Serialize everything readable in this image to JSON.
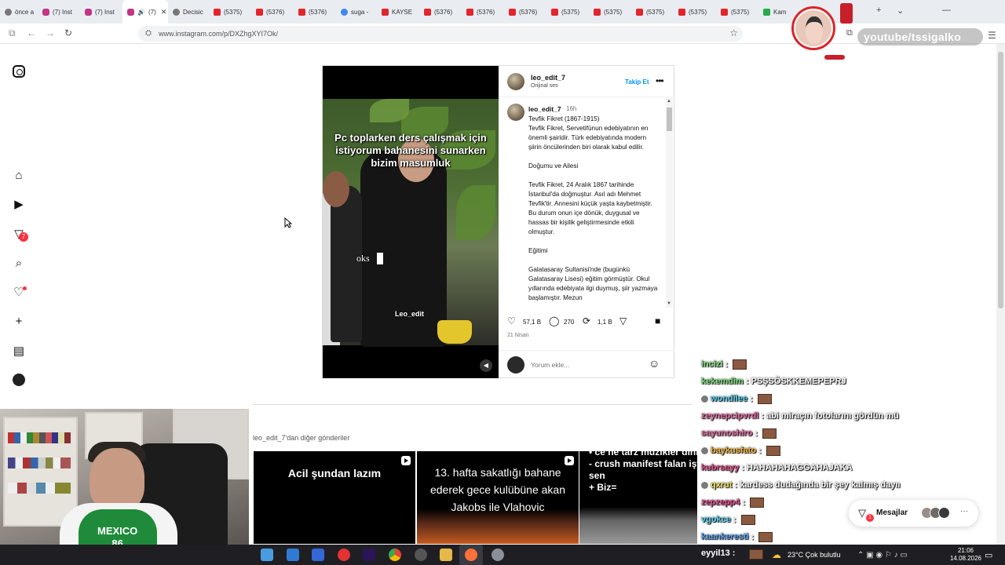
{
  "browser": {
    "tabs": [
      {
        "label": "önce a",
        "icon": "gray",
        "active": false
      },
      {
        "label": "(7) Inst",
        "icon": "ig",
        "active": false
      },
      {
        "label": "(7) Inst",
        "icon": "ig",
        "active": false
      },
      {
        "label": "(7)",
        "icon": "ig",
        "active": true
      },
      {
        "label": "Decisic",
        "icon": "gray",
        "active": false
      },
      {
        "label": "(5375)",
        "icon": "yt",
        "active": false
      },
      {
        "label": "(5376)",
        "icon": "yt",
        "active": false
      },
      {
        "label": "(5376)",
        "icon": "yt",
        "active": false
      },
      {
        "label": "suga -",
        "icon": "google",
        "active": false
      },
      {
        "label": "KAYSE",
        "icon": "yt",
        "active": false
      },
      {
        "label": "(5376)",
        "icon": "yt",
        "active": false
      },
      {
        "label": "(5376)",
        "icon": "yt",
        "active": false
      },
      {
        "label": "(5376)",
        "icon": "yt",
        "active": false
      },
      {
        "label": "(5375)",
        "icon": "yt",
        "active": false
      },
      {
        "label": "(5375)",
        "icon": "yt",
        "active": false
      },
      {
        "label": "(5375)",
        "icon": "yt",
        "active": false
      },
      {
        "label": "(5375)",
        "icon": "yt",
        "active": false
      },
      {
        "label": "(5375)",
        "icon": "yt",
        "active": false
      },
      {
        "label": "Kam",
        "icon": "green",
        "active": false
      }
    ],
    "url": "www.instagram.com/p/DXZhgXYI7Ok/",
    "new_tab_symbol": "+",
    "minimize_symbol": "—",
    "restore_symbol": "❐",
    "close_symbol": "✕"
  },
  "stream_overlay": {
    "channel_tag": "youtube/tssigalko"
  },
  "sidebar": {
    "notification_count": "7"
  },
  "post": {
    "author": "leo_edit_7",
    "audio": "Orijinal ses",
    "follow_label": "Takip Et",
    "video": {
      "caption": "Pc toplarken ders çalışmak için istiyorum bahanesini sunarken bizim masumluk",
      "subtitle": "oks",
      "brand": "Leo_edit"
    },
    "caption": {
      "author": "leo_edit_7",
      "time": "16h",
      "paragraphs": [
        "Tevfik Fikret (1867-1915)\nTevfik Fikret, Servetifünun edebiyatının en önemli şairidir. Türk edebiyatında modern şiirin öncülerinden biri olarak kabul edilir.",
        "Doğumu ve Ailesi",
        "Tevfik Fikret, 24 Aralık 1867 tarihinde İstanbul'da doğmuştur. Asıl adı Mehmet Tevfik'tir. Annesini küçük yaşta kaybetmiştir. Bu durum onun içe dönük, duygusal ve hassas bir kişilik geliştirmesinde etkili olmuştur.",
        "Eğitimi",
        "Galatasaray Sultanisi'nde (bugünkü Galatasaray Lisesi) eğitim görmüştür. Okul yıllarında edebiyata ilgi duymuş, şiir yazmaya başlamıştır. Mezun"
      ]
    },
    "likes": "57,1 B",
    "comments": "270",
    "reposts": "1,1 B",
    "date": "21 Nisan",
    "comment_placeholder": "Yorum ekle..."
  },
  "more_posts": {
    "heading": "leo_edit_7'dan diğer gönderiler",
    "items": [
      {
        "text": "Acil şundan lazım"
      },
      {
        "text": "13. hafta sakatlığı bahane ederek gece kulübüne akan Jakobs ile Vlahovic"
      },
      {
        "text": "• ce ne tarz müzikler dinlersin\n- crush manifest falan işte sen\n+ Biz="
      }
    ]
  },
  "webcam": {
    "shirt_text": "MEXICO\n86"
  },
  "chat": [
    {
      "user": "incizi",
      "color": "#7fe07f",
      "message": "",
      "emote": true,
      "prefix": false
    },
    {
      "user": "kekemdim",
      "color": "#7fe07f",
      "message": "PSŞSÖSKKEMEPEPRJ",
      "emote": false,
      "prefix": false
    },
    {
      "user": "wondilee",
      "color": "#5ad0f0",
      "message": "",
      "emote": true,
      "prefix": true
    },
    {
      "user": "zeynepcipvrdl",
      "color": "#e46aa0",
      "message": "abi miraçın fotolarını gördün mü",
      "emote": false,
      "prefix": false
    },
    {
      "user": "sayunoshiro",
      "color": "#e46aa0",
      "message": "",
      "emote": true,
      "prefix": false
    },
    {
      "user": "baykusfato",
      "color": "#f3b33b",
      "message": "",
      "emote": true,
      "prefix": true
    },
    {
      "user": "kubrsayy",
      "color": "#e04a8a",
      "message": "HAHAHAHAGGAHAJAKA",
      "emote": false,
      "prefix": false
    },
    {
      "user": "qxrut",
      "color": "#f0e05a",
      "message": "kardess dudağında bir şey kalmış dayıı",
      "emote": false,
      "prefix": true
    },
    {
      "user": "zepzepp4",
      "color": "#e04a8a",
      "message": "",
      "emote": true,
      "prefix": false
    },
    {
      "user": "vgokce",
      "color": "#5ad0f0",
      "message": "",
      "emote": true,
      "prefix": false
    },
    {
      "user": "kaankeresti",
      "color": "#5aa0f0",
      "message": "",
      "emote": true,
      "prefix": false
    }
  ],
  "messages_pill": {
    "label": "Mesajlar",
    "badge": "1"
  },
  "taskbar": {
    "chat_user": "eyyil13 :",
    "weather": "23°C  Çok bulutlu",
    "time": "21:06",
    "date": "14.08.2026"
  }
}
